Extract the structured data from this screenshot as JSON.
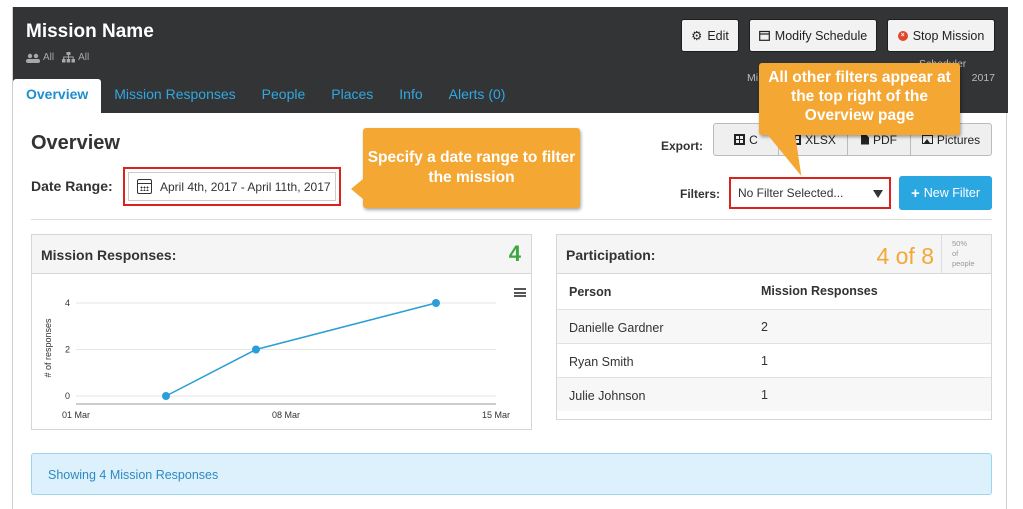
{
  "header": {
    "mission_name": "Mission Name",
    "scope_users": "All",
    "scope_groups": "All",
    "buttons": {
      "edit": "Edit",
      "modify": "Modify Schedule",
      "stop": "Stop Mission"
    },
    "schedule_line1": "Scheduler",
    "schedule_line2_left": "Mi",
    "schedule_line2_right": "2017"
  },
  "tabs": [
    {
      "label": "Overview",
      "active": true
    },
    {
      "label": "Mission Responses",
      "active": false
    },
    {
      "label": "People",
      "active": false
    },
    {
      "label": "Places",
      "active": false
    },
    {
      "label": "Info",
      "active": false
    },
    {
      "label": "Alerts (0)",
      "active": false
    }
  ],
  "overview": {
    "title": "Overview",
    "date_range_label": "Date Range:",
    "date_range_value": "April 4th, 2017 - April 11th, 2017",
    "export_label": "Export:",
    "export_buttons": [
      "CSV",
      "XLSX",
      "PDF",
      "Pictures"
    ],
    "export_first_visible": "C",
    "filters_label": "Filters:",
    "filter_value": "No Filter Selected...",
    "new_filter": "New Filter"
  },
  "callouts": {
    "date": "Specify a date range to filter the mission",
    "filters": "All other filters appear at the top right of the Overview page"
  },
  "responses_panel": {
    "title": "Mission Responses:",
    "count": "4",
    "accent_color": "#3aa83f"
  },
  "chart_data": {
    "type": "line",
    "x": [
      "2017-03-04",
      "2017-03-07",
      "2017-03-13"
    ],
    "values": [
      0,
      2,
      4
    ],
    "xticks": [
      "01 Mar",
      "08 Mar",
      "15 Mar"
    ],
    "yticks": [
      "0",
      "2",
      "4"
    ],
    "ylabel": "# of responses",
    "ylim": [
      0,
      4
    ],
    "grid": true,
    "color": "#2a9fd6"
  },
  "participation_panel": {
    "title": "Participation:",
    "count": "4 of 8",
    "percent": "50%",
    "percent_unit1": "of",
    "percent_unit2": "people",
    "columns": [
      "Person",
      "Mission Responses"
    ],
    "rows": [
      {
        "person": "Danielle Gardner",
        "responses": "2"
      },
      {
        "person": "Ryan Smith",
        "responses": "1"
      },
      {
        "person": "Julie Johnson",
        "responses": "1"
      }
    ]
  },
  "status": {
    "message": "Showing 4 Mission Responses"
  },
  "colors": {
    "header_bg": "#333435",
    "link": "#31a8e0",
    "callout": "#f4a733",
    "highlight": "#d9231f"
  }
}
